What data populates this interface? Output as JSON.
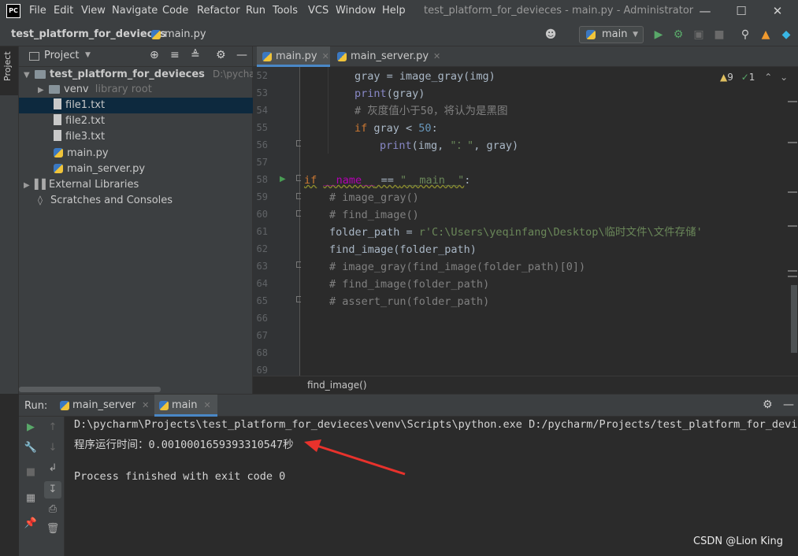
{
  "window": {
    "title": "test_platform_for_devieces - main.py - Administrator",
    "logo": "PC",
    "menu": [
      "File",
      "Edit",
      "View",
      "Navigate",
      "Code",
      "Refactor",
      "Run",
      "Tools",
      "VCS",
      "Window",
      "Help"
    ],
    "controls": [
      "minimize-icon",
      "maximize-icon",
      "close-icon"
    ]
  },
  "navbar": {
    "project": "test_platform_for_devieces",
    "file": "main.py",
    "run_config": "main"
  },
  "sidestrip": {
    "project_tab": "Project"
  },
  "project_panel": {
    "title": "Project",
    "root": "test_platform_for_devieces",
    "root_path": "D:\\pycharm\\Pr",
    "items": [
      {
        "label": "venv",
        "hint": "library root",
        "kind": "folder"
      },
      {
        "label": "file1.txt",
        "kind": "txt"
      },
      {
        "label": "file2.txt",
        "kind": "txt"
      },
      {
        "label": "file3.txt",
        "kind": "txt"
      },
      {
        "label": "main.py",
        "kind": "py"
      },
      {
        "label": "main_server.py",
        "kind": "py"
      },
      {
        "label": "External Libraries",
        "kind": "lib"
      },
      {
        "label": "Scratches and Consoles",
        "kind": "scratch"
      }
    ]
  },
  "editor": {
    "tabs": [
      "main.py",
      "main_server.py"
    ],
    "warnings": "9",
    "checks": "1",
    "line_numbers": [
      "52",
      "53",
      "54",
      "55",
      "56",
      "57",
      "58",
      "59",
      "60",
      "61",
      "62",
      "63",
      "64",
      "65",
      "66",
      "67",
      "68",
      "69"
    ],
    "lines": {
      "l52a": "gray = image_gray(img)",
      "l53_fn": "print",
      "l53_rest": "(gray)",
      "l54": "# 灰度值小于50，将认为是黑图",
      "l55_kw": "if",
      "l55_mid": " gray < ",
      "l55_num": "50",
      "l55_end": ":",
      "l56_fn": "print",
      "l56_a": "(img, ",
      "l56_str": "\"：\"",
      "l56_b": ", gray)",
      "l58_kw": "if",
      "l58_name": "__name__",
      "l58_eq": " == ",
      "l58_str": "\"__main__\"",
      "l58_end": ":",
      "l59": "# image_gray()",
      "l60": "# find_image()",
      "l61_a": "folder_path = ",
      "l61_str": "r'C:\\Users\\yeqinfang\\Desktop\\临时文件\\文件存储'",
      "l62": "find_image(folder_path)",
      "l63": "# image_gray(find_image(folder_path)[0])",
      "l64": "# find_image(folder_path)",
      "l65": "# assert_run(folder_path)"
    },
    "breadcrumb": "find_image()"
  },
  "run_panel": {
    "label": "Run:",
    "tabs": [
      "main_server",
      "main"
    ],
    "console": [
      "D:\\pycharm\\Projects\\test_platform_for_devieces\\venv\\Scripts\\python.exe D:/pycharm/Projects/test_platform_for_deviec",
      "程序运行时间：0.0010001659393310547秒",
      "",
      "Process finished with exit code 0"
    ]
  },
  "watermark": "CSDN @Lion King",
  "colors": {
    "accent": "#4a88c7",
    "arrow": "#e8322c"
  }
}
